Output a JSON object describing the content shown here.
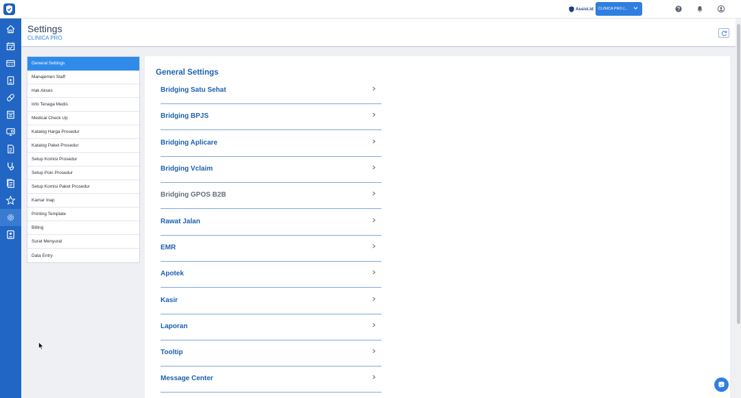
{
  "app": {
    "brand": "Assist.id",
    "clinic_selector": "CLINICA PRO (..."
  },
  "colors": {
    "accent": "#2f8bea",
    "rail": "#2166c4",
    "section_text": "#1c60ad",
    "muted_text": "#686e78"
  },
  "rail": {
    "icons": [
      "home-icon",
      "calendar-check-icon",
      "registration-icon",
      "medical-record-icon",
      "pill-icon",
      "pharmacy-icon",
      "monitor-icon",
      "document-icon",
      "stethoscope-icon",
      "report-icon",
      "star-icon",
      "gear-icon",
      "id-card-icon"
    ],
    "active": "gear-icon"
  },
  "header": {
    "title": "Settings",
    "subtitle": "CLINICA PRO"
  },
  "menu": {
    "items": [
      {
        "label": "General Settings",
        "active": true
      },
      {
        "label": "Manajemen Staff",
        "active": false
      },
      {
        "label": "Hak Akses",
        "active": false
      },
      {
        "label": "Info Tenaga Medis",
        "active": false
      },
      {
        "label": "Medical Check Up",
        "active": false
      },
      {
        "label": "Katalog Harga Prosedur",
        "active": false
      },
      {
        "label": "Katalog Paket Prosedur",
        "active": false
      },
      {
        "label": "Setup Komisi Prosedur",
        "active": false
      },
      {
        "label": "Setup Poin Prosedur",
        "active": false
      },
      {
        "label": "Setup Komisi Paket Prosedur",
        "active": false
      },
      {
        "label": "Kamar Inap",
        "active": false
      },
      {
        "label": "Printing Template",
        "active": false
      },
      {
        "label": "Billing",
        "active": false
      },
      {
        "label": "Surat Menyurat",
        "active": false
      },
      {
        "label": "Data Entry",
        "active": false
      }
    ]
  },
  "content": {
    "title": "General Settings",
    "sections": [
      {
        "label": "Bridging Satu Sehat",
        "enabled": true
      },
      {
        "label": "Bridging BPJS",
        "enabled": true
      },
      {
        "label": "Bridging Aplicare",
        "enabled": true
      },
      {
        "label": "Bridging Vclaim",
        "enabled": true
      },
      {
        "label": "Bridging GPOS B2B",
        "enabled": false
      },
      {
        "label": "Rawat Jalan",
        "enabled": true
      },
      {
        "label": "EMR",
        "enabled": true
      },
      {
        "label": "Apotek",
        "enabled": true
      },
      {
        "label": "Kasir",
        "enabled": true
      },
      {
        "label": "Laporan",
        "enabled": true
      },
      {
        "label": "Tooltip",
        "enabled": true
      },
      {
        "label": "Message Center",
        "enabled": true
      }
    ]
  }
}
